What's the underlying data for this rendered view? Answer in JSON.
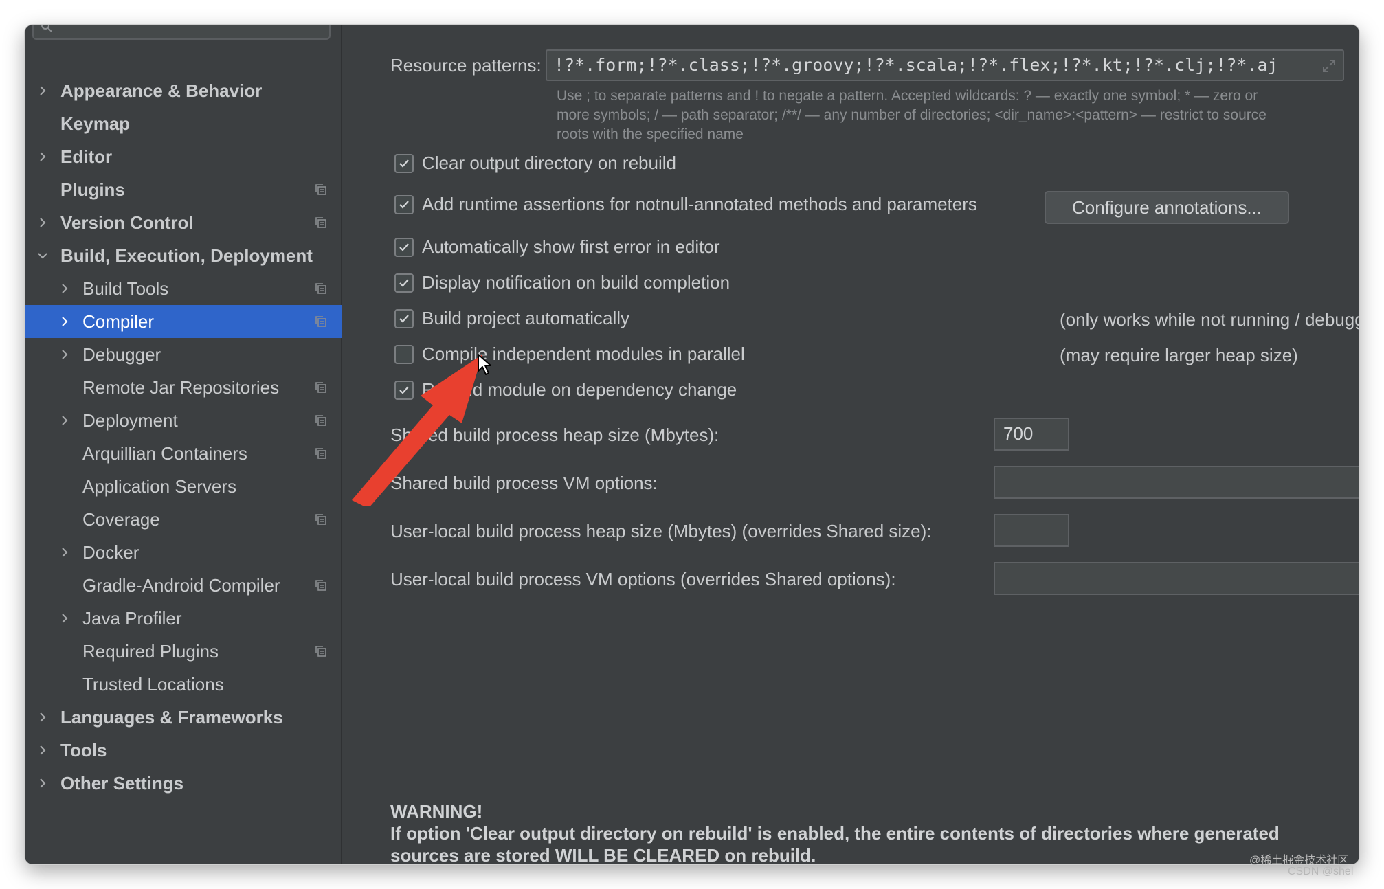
{
  "sidebar": {
    "items": [
      {
        "label": "Appearance & Behavior",
        "level": 0,
        "bold": true,
        "expandable": true,
        "expanded": false,
        "project_icon": false
      },
      {
        "label": "Keymap",
        "level": 0,
        "bold": true,
        "expandable": false,
        "project_icon": false
      },
      {
        "label": "Editor",
        "level": 0,
        "bold": true,
        "expandable": true,
        "expanded": false,
        "project_icon": false
      },
      {
        "label": "Plugins",
        "level": 0,
        "bold": true,
        "expandable": false,
        "project_icon": true
      },
      {
        "label": "Version Control",
        "level": 0,
        "bold": true,
        "expandable": true,
        "expanded": false,
        "project_icon": true
      },
      {
        "label": "Build, Execution, Deployment",
        "level": 0,
        "bold": true,
        "expandable": true,
        "expanded": true,
        "project_icon": false
      },
      {
        "label": "Build Tools",
        "level": 1,
        "bold": false,
        "expandable": true,
        "expanded": false,
        "project_icon": true
      },
      {
        "label": "Compiler",
        "level": 1,
        "bold": false,
        "expandable": true,
        "expanded": false,
        "project_icon": true,
        "selected": true
      },
      {
        "label": "Debugger",
        "level": 1,
        "bold": false,
        "expandable": true,
        "expanded": false,
        "project_icon": false
      },
      {
        "label": "Remote Jar Repositories",
        "level": 1,
        "bold": false,
        "expandable": false,
        "project_icon": true
      },
      {
        "label": "Deployment",
        "level": 1,
        "bold": false,
        "expandable": true,
        "expanded": false,
        "project_icon": true
      },
      {
        "label": "Arquillian Containers",
        "level": 1,
        "bold": false,
        "expandable": false,
        "project_icon": true
      },
      {
        "label": "Application Servers",
        "level": 1,
        "bold": false,
        "expandable": false,
        "project_icon": false
      },
      {
        "label": "Coverage",
        "level": 1,
        "bold": false,
        "expandable": false,
        "project_icon": true
      },
      {
        "label": "Docker",
        "level": 1,
        "bold": false,
        "expandable": true,
        "expanded": false,
        "project_icon": false
      },
      {
        "label": "Gradle-Android Compiler",
        "level": 1,
        "bold": false,
        "expandable": false,
        "project_icon": true
      },
      {
        "label": "Java Profiler",
        "level": 1,
        "bold": false,
        "expandable": true,
        "expanded": false,
        "project_icon": false
      },
      {
        "label": "Required Plugins",
        "level": 1,
        "bold": false,
        "expandable": false,
        "project_icon": true
      },
      {
        "label": "Trusted Locations",
        "level": 1,
        "bold": false,
        "expandable": false,
        "project_icon": false
      },
      {
        "label": "Languages & Frameworks",
        "level": 0,
        "bold": true,
        "expandable": true,
        "expanded": false,
        "project_icon": false
      },
      {
        "label": "Tools",
        "level": 0,
        "bold": true,
        "expandable": true,
        "expanded": false,
        "project_icon": false
      },
      {
        "label": "Other Settings",
        "level": 0,
        "bold": true,
        "expandable": true,
        "expanded": false,
        "project_icon": false
      }
    ]
  },
  "compiler": {
    "resource_patterns_label": "Resource patterns:",
    "resource_patterns_value": "!?*.form;!?*.class;!?*.groovy;!?*.scala;!?*.flex;!?*.kt;!?*.clj;!?*.aj",
    "hint_line1": "Use ; to separate patterns and ! to negate a pattern. Accepted wildcards: ? — exactly one symbol; * — zero or",
    "hint_line2": "more symbols; / — path separator; /**/ — any number of directories; <dir_name>:<pattern> — restrict to source",
    "hint_line3": "roots with the specified name",
    "options": [
      {
        "label": "Clear output directory on rebuild",
        "checked": true
      },
      {
        "label": "Add runtime assertions for notnull-annotated methods and parameters",
        "checked": true
      },
      {
        "label": "Automatically show first error in editor",
        "checked": true
      },
      {
        "label": "Display notification on build completion",
        "checked": true
      },
      {
        "label": "Build project automatically",
        "checked": true
      },
      {
        "label": "Compile independent modules in parallel",
        "checked": false
      },
      {
        "label": "Rebuild module on dependency change",
        "checked": true
      }
    ],
    "configure_annotations_button": "Configure annotations...",
    "note_build_auto": "(only works while not running / debugging)",
    "note_parallel": "(may require larger heap size)",
    "heap_label": "Shared build process heap size (Mbytes):",
    "heap_value": "700",
    "vm_options_label": "Shared build process VM options:",
    "vm_options_value": "",
    "user_heap_label": "User-local build process heap size (Mbytes) (overrides Shared size):",
    "user_heap_value": "",
    "user_vm_label": "User-local build process VM options (overrides Shared options):",
    "user_vm_value": "",
    "warning_title": "WARNING!",
    "warning_line1": "If option 'Clear output directory on rebuild' is enabled, the entire contents of directories where generated",
    "warning_line2": "sources are stored WILL BE CLEARED on rebuild."
  },
  "watermark": {
    "line1": "@稀土掘金技术社区",
    "line2": "CSDN @shel"
  },
  "colors": {
    "window_bg": "#3c3f41",
    "selection": "#2f65ca",
    "annotation_arrow": "#e8402f"
  }
}
